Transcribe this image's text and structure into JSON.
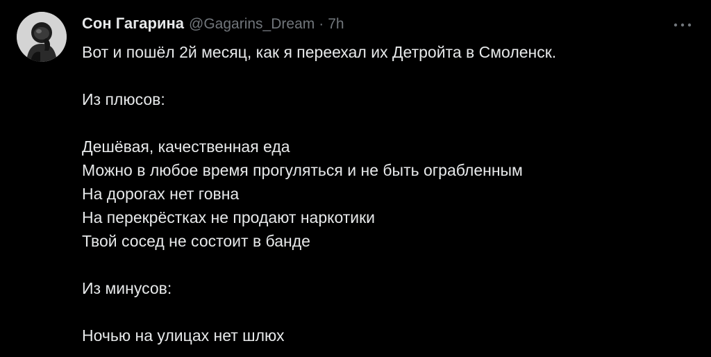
{
  "tweet": {
    "author_name": "Сон Гагарина",
    "handle": "@Gagarins_Dream",
    "separator": "·",
    "time": "7h",
    "more_icon": "more-horizontal-icon",
    "lines": [
      "Вот и пошёл 2й месяц, как я переехал их Детройта в Смоленск.",
      "",
      "Из плюсов:",
      "",
      "Дешёвая, качественная еда",
      "Можно в любое время прогуляться и не быть ограбленным",
      "На дорогах нет говна",
      "На перекрёстках не продают наркотики",
      "Твой сосед не состоит в банде",
      "",
      "Из минусов:",
      "",
      "Ночью на улицах нет шлюх"
    ]
  },
  "colors": {
    "background": "#000000",
    "primary_text": "#e7e9ea",
    "secondary_text": "#71767b"
  }
}
